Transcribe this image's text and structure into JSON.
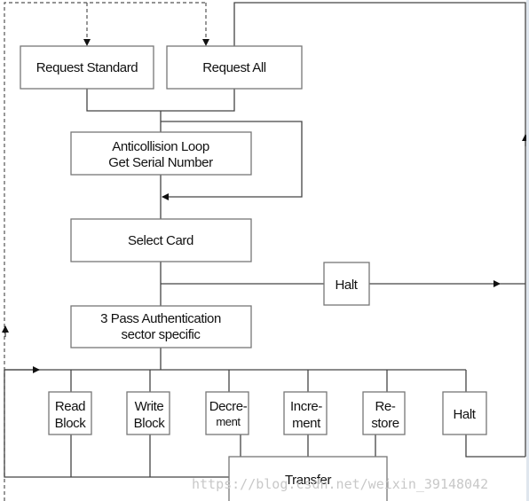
{
  "nodes": {
    "request_standard": "Request Standard",
    "request_all": "Request All",
    "anticollision": [
      "Anticollision Loop",
      "Get Serial Number"
    ],
    "select_card": "Select Card",
    "halt_top": "Halt",
    "authentication": [
      "3 Pass Authentication",
      "sector specific"
    ],
    "read_block": [
      "Read",
      "Block"
    ],
    "write_block": [
      "Write",
      "Block"
    ],
    "decrement": [
      "Decre-",
      "ment"
    ],
    "increment": [
      "Incre-",
      "ment"
    ],
    "restore": [
      "Re-",
      "store"
    ],
    "halt_bottom": "Halt",
    "transfer": "Transfer"
  },
  "watermark": "https://blog.csdn.net/weixin_39148042"
}
